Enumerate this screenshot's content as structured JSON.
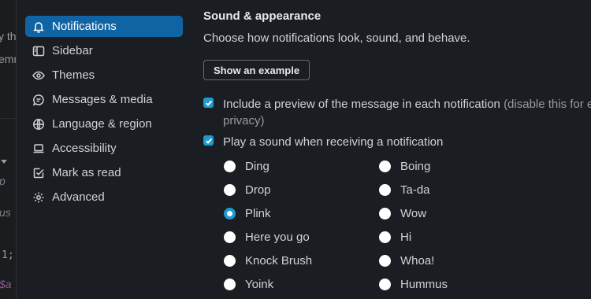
{
  "background": {
    "fragments": [
      "y th",
      "emn",
      "p",
      "us",
      "1;",
      "$a"
    ]
  },
  "sidebar": {
    "items": [
      {
        "label": "Notifications",
        "icon": "bell-icon",
        "active": true
      },
      {
        "label": "Sidebar",
        "icon": "sidebar-icon",
        "active": false
      },
      {
        "label": "Themes",
        "icon": "eye-icon",
        "active": false
      },
      {
        "label": "Messages & media",
        "icon": "message-icon",
        "active": false
      },
      {
        "label": "Language & region",
        "icon": "globe-icon",
        "active": false
      },
      {
        "label": "Accessibility",
        "icon": "laptop-icon",
        "active": false
      },
      {
        "label": "Mark as read",
        "icon": "check-square-icon",
        "active": false
      },
      {
        "label": "Advanced",
        "icon": "gear-icon",
        "active": false
      }
    ]
  },
  "main": {
    "title": "Sound & appearance",
    "description": "Choose how notifications look, sound, and behave.",
    "example_button": "Show an example",
    "preview_checkbox": {
      "label": "Include a preview of the message in each notification",
      "hint_line1": "(disable this for ex",
      "hint_line2": "privacy)",
      "checked": true
    },
    "sound_checkbox": {
      "label": "Play a sound when receiving a notification",
      "checked": true
    },
    "sounds": {
      "left": [
        "Ding",
        "Drop",
        "Plink",
        "Here you go",
        "Knock Brush",
        "Yoink"
      ],
      "right": [
        "Boing",
        "Ta-da",
        "Wow",
        "Hi",
        "Whoa!",
        "Hummus"
      ],
      "selected": "Plink"
    }
  },
  "colors": {
    "accent": "#1164a3",
    "checkbox": "#1d9bd1",
    "background": "#1a1d21"
  }
}
